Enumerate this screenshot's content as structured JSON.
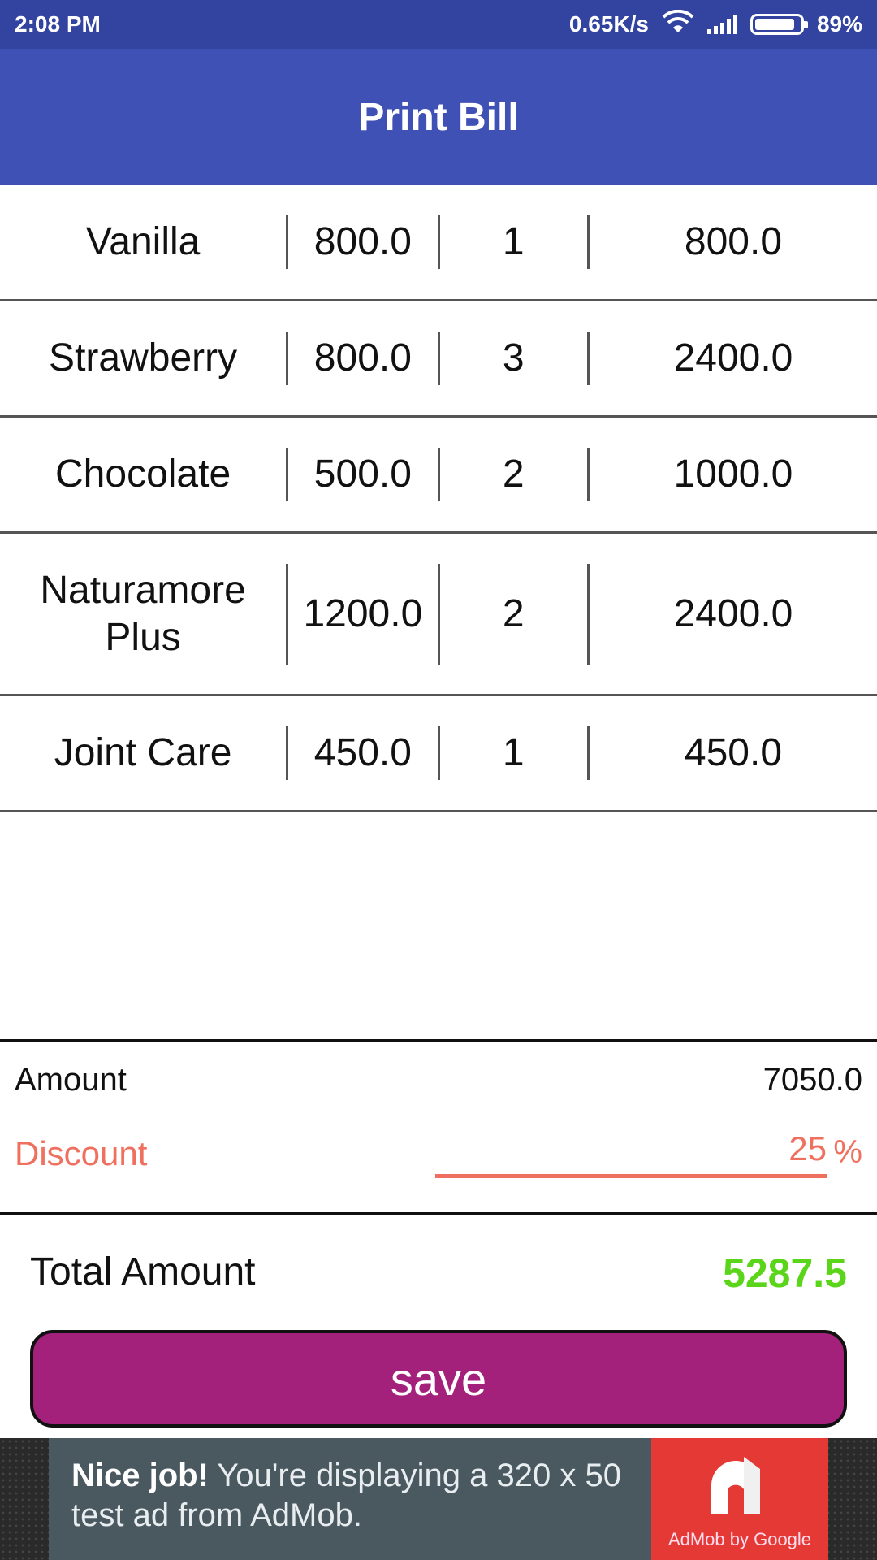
{
  "status_bar": {
    "time": "2:08 PM",
    "speed": "0.65K/s",
    "battery": "89%",
    "battery_level": 0.89
  },
  "app_bar": {
    "title": "Print Bill"
  },
  "items": [
    {
      "name": "Vanilla",
      "price": "800.0",
      "qty": "1",
      "total": "800.0"
    },
    {
      "name": "Strawberry",
      "price": "800.0",
      "qty": "3",
      "total": "2400.0"
    },
    {
      "name": "Chocolate",
      "price": "500.0",
      "qty": "2",
      "total": "1000.0"
    },
    {
      "name": "Naturamore Plus",
      "price": "1200.0",
      "qty": "2",
      "total": "2400.0"
    },
    {
      "name": "Joint Care",
      "price": "450.0",
      "qty": "1",
      "total": "450.0"
    }
  ],
  "amount": {
    "label": "Amount",
    "value": "7050.0"
  },
  "discount": {
    "label": "Discount",
    "value": "25",
    "unit": "%"
  },
  "total": {
    "label": "Total Amount",
    "value": "5287.5"
  },
  "save_button": {
    "label": "save"
  },
  "ad": {
    "bold": "Nice job!",
    "text": " You're displaying a 320 x 50 test ad from AdMob.",
    "caption": "AdMob by Google"
  },
  "colors": {
    "status_bar": "#3344a0",
    "app_bar": "#3f51b5",
    "accent_discount": "#f07060",
    "total_value": "#5ad51a",
    "save_button": "#a3217b",
    "ad_logo": "#e53935"
  }
}
